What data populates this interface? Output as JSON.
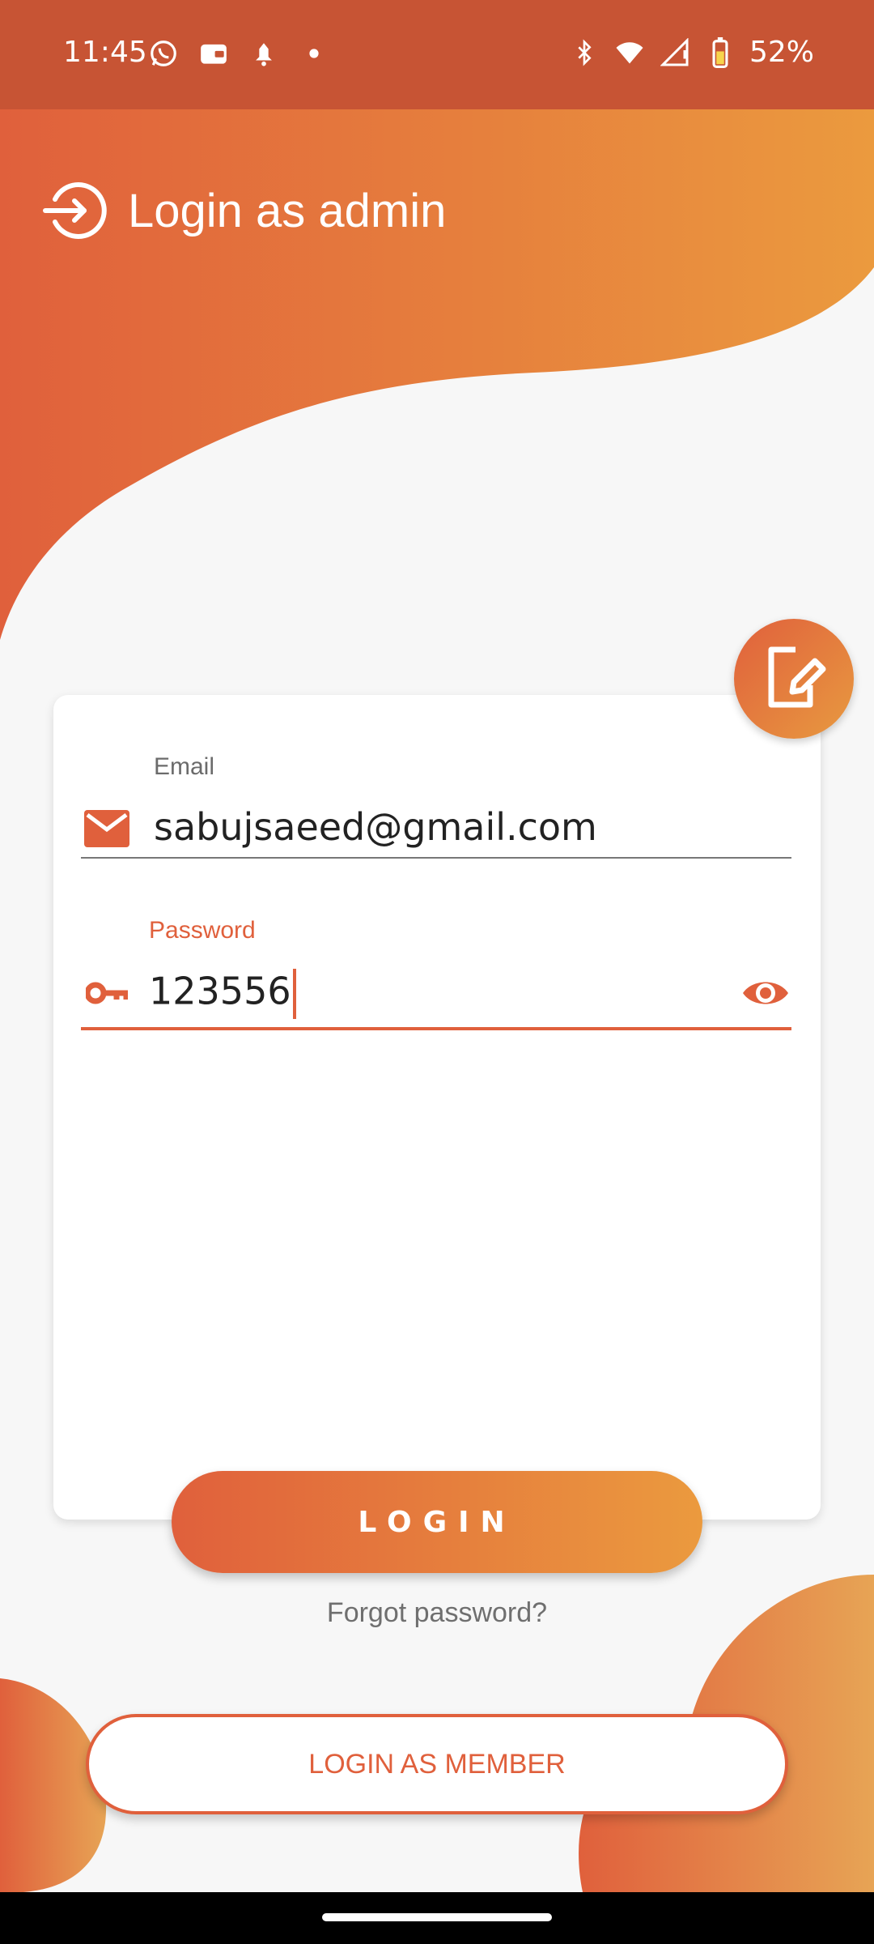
{
  "status_bar": {
    "time": "11:45",
    "battery": "52%",
    "left_icons": [
      "whatsapp-icon",
      "wallet-icon",
      "bell-icon",
      "dot-icon"
    ],
    "right_icons": [
      "bluetooth-icon",
      "wifi-icon",
      "signal-icon",
      "battery-icon"
    ]
  },
  "header": {
    "title": "Login as admin",
    "icon": "login-icon"
  },
  "form": {
    "email_label": "Email",
    "email_value": "sabujsaeed@gmail.com",
    "password_label": "Password",
    "password_value": "123556",
    "email_icon": "mail-icon",
    "password_icon": "key-icon",
    "toggle_icon": "eye-icon"
  },
  "fab": {
    "icon": "edit-icon"
  },
  "buttons": {
    "login": "LOGIN",
    "forgot": "Forgot password?",
    "member": "LOGIN AS MEMBER"
  },
  "colors": {
    "accent": "#e0603c",
    "accent_light": "#eb9a3e",
    "status_bar": "#c75434"
  }
}
